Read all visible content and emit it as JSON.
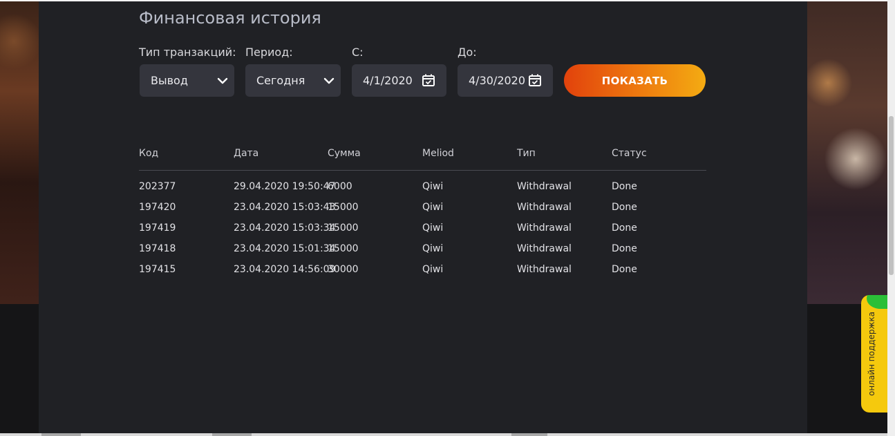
{
  "page": {
    "title": "Финансовая история"
  },
  "filters": {
    "type_label": "Тип транзакций:",
    "type_value": "Вывод",
    "period_label": "Период:",
    "period_value": "Сегодня",
    "from_label": "С:",
    "from_value": "4/1/2020",
    "to_label": "До:",
    "to_value": "4/30/2020",
    "show_button": "ПОКАЗАТЬ"
  },
  "table": {
    "columns": [
      "Код",
      "Дата",
      "Сумма",
      "Meliod",
      "Тип",
      "Статус"
    ],
    "rows": [
      [
        "202377",
        "29.04.2020 19:50:47",
        "6000",
        "Qiwi",
        "Withdrawal",
        "Done"
      ],
      [
        "197420",
        "23.04.2020 15:03:43",
        "15000",
        "Qiwi",
        "Withdrawal",
        "Done"
      ],
      [
        "197419",
        "23.04.2020 15:03:34",
        "15000",
        "Qiwi",
        "Withdrawal",
        "Done"
      ],
      [
        "197418",
        "23.04.2020 15:01:34",
        "15000",
        "Qiwi",
        "Withdrawal",
        "Done"
      ],
      [
        "197415",
        "23.04.2020 14:56:09",
        "30000",
        "Qiwi",
        "Withdrawal",
        "Done"
      ]
    ]
  },
  "support": {
    "label": "онлайн поддержка"
  },
  "icons": {
    "select": "chevron-down-icon",
    "date": "calendar-icon"
  },
  "colors": {
    "panel": "#202125",
    "field": "#34353d",
    "button_start": "#e2420c",
    "button_end": "#f4ab12",
    "support": "#f5c90d"
  }
}
